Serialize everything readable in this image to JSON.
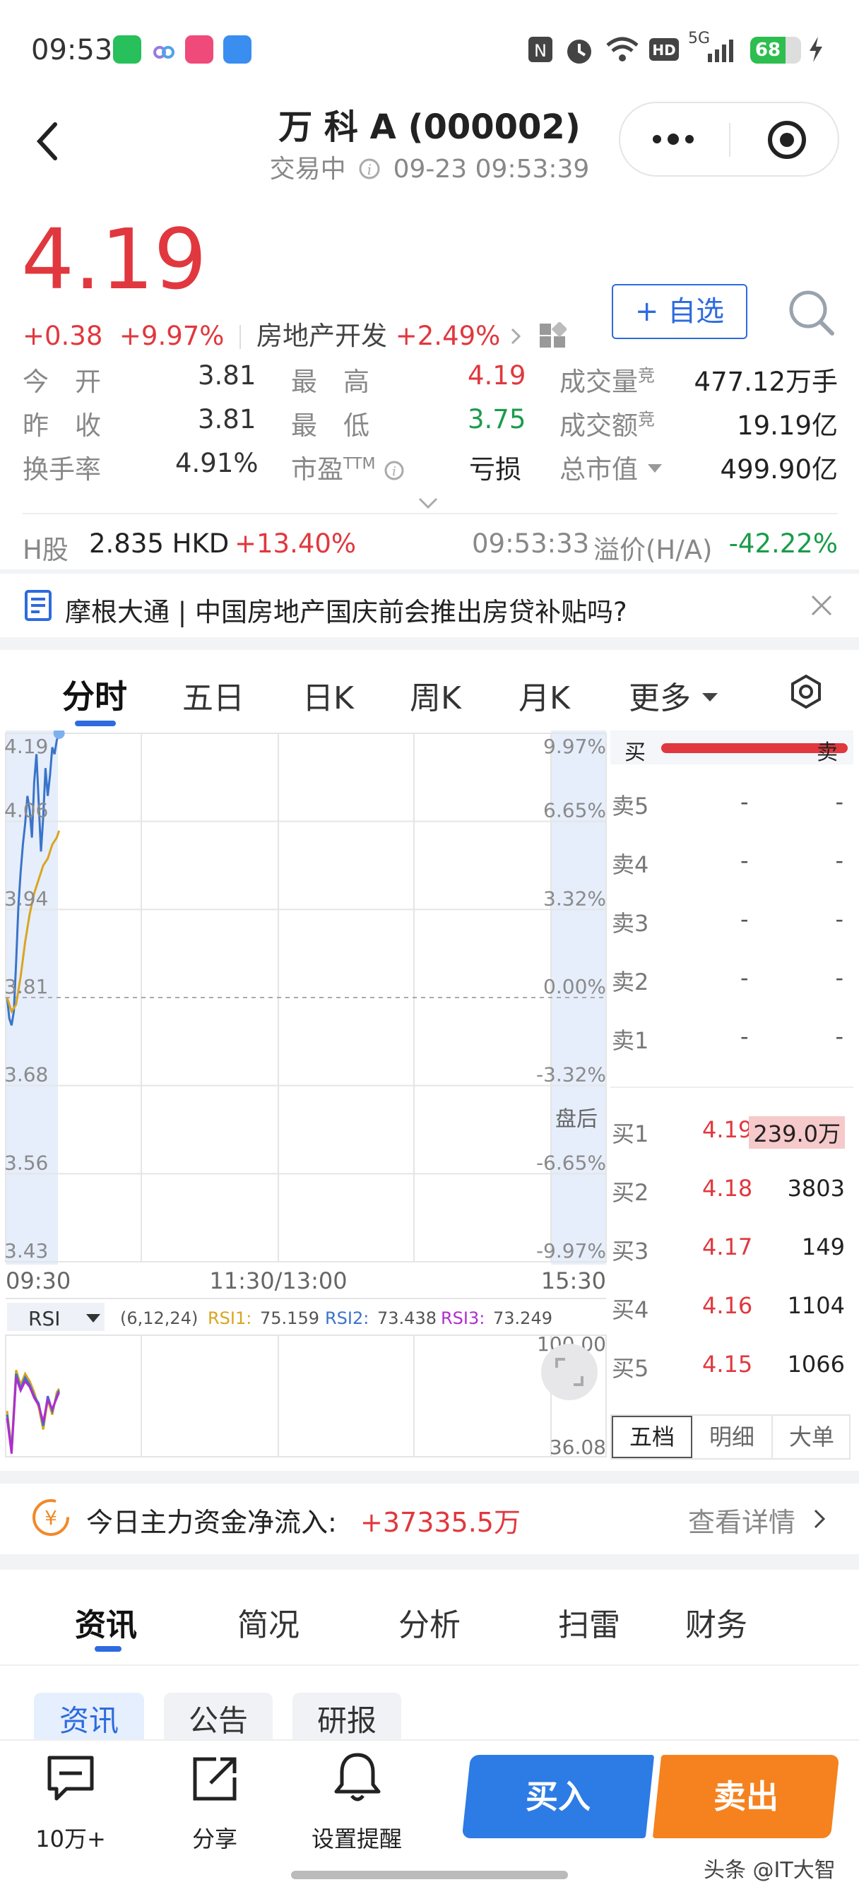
{
  "status_bar": {
    "time": "09:53",
    "network": "5G",
    "battery": "68"
  },
  "header": {
    "title": "万 科 A (000002)",
    "status": "交易中",
    "datetime": "09-23 09:53:39"
  },
  "quote": {
    "price": "4.19",
    "change": "+0.38",
    "change_pct": "+9.97%",
    "sector": "房地产开发",
    "sector_pct": "+2.49%",
    "favorite_label": "+ 自选",
    "rows": [
      [
        {
          "label": "今　开",
          "value": "3.81"
        },
        {
          "label": "最　高",
          "value": "4.19",
          "color": "red"
        },
        {
          "label": "成交量",
          "sup": "竞",
          "value": "477.12万手"
        }
      ],
      [
        {
          "label": "昨　收",
          "value": "3.81"
        },
        {
          "label": "最　低",
          "value": "3.75",
          "color": "green"
        },
        {
          "label": "成交额",
          "sup": "竞",
          "value": "19.19亿"
        }
      ],
      [
        {
          "label": "换手率",
          "value": "4.91%"
        },
        {
          "label": "市盈",
          "sup": "TTM",
          "value": "亏损",
          "color": "dark"
        },
        {
          "label": "总市值",
          "value": "499.90亿"
        }
      ]
    ]
  },
  "hshare": {
    "label": "H股",
    "price": "2.835 HKD",
    "pct": "+13.40%",
    "time": "09:53:33",
    "premium_label": "溢价(H/A)",
    "premium": "-42.22%"
  },
  "news": {
    "text": "摩根大通 | 中国房地产国庆前会推出房贷补贴吗?"
  },
  "chart_tabs": [
    "分时",
    "五日",
    "日K",
    "周K",
    "月K",
    "更多"
  ],
  "chart_data": {
    "type": "line",
    "y_left_ticks": [
      "4.19",
      "4.06",
      "3.94",
      "3.81",
      "3.68",
      "3.56",
      "3.43"
    ],
    "y_right_ticks": [
      "9.97%",
      "6.65%",
      "3.32%",
      "0.00%",
      "-3.32%",
      "-6.65%",
      "-9.97%"
    ],
    "x_ticks": [
      "09:30",
      "11:30/13:00",
      "15:30"
    ],
    "ylim": [
      3.43,
      4.19
    ],
    "after_hours_label": "盘后",
    "series": [
      {
        "name": "",
        "color": "#3a74c9",
        "x": [
          0,
          1,
          2,
          3,
          4,
          5,
          6,
          7,
          8,
          9,
          10,
          11,
          12,
          13,
          14,
          15,
          16,
          17,
          18,
          19,
          20,
          21,
          22,
          23
        ],
        "y": [
          3.81,
          3.78,
          3.77,
          3.79,
          3.86,
          3.94,
          3.99,
          4.03,
          4.06,
          4.1,
          4.08,
          4.04,
          4.12,
          4.16,
          4.09,
          4.02,
          4.07,
          4.14,
          4.1,
          4.13,
          4.17,
          4.16,
          4.18,
          4.19
        ]
      },
      {
        "name": "",
        "color": "#d9a521",
        "x": [
          0,
          2,
          4,
          6,
          8,
          10,
          12,
          14,
          16,
          18,
          20,
          22,
          23
        ],
        "y": [
          3.81,
          3.79,
          3.8,
          3.84,
          3.89,
          3.93,
          3.96,
          3.98,
          4.0,
          4.01,
          4.03,
          4.04,
          4.05
        ]
      }
    ],
    "rsi": {
      "label": "RSI",
      "params": "(6,12,24)",
      "rsi1_label": "RSI1:",
      "rsi1": "75.159",
      "rsi2_label": "RSI2:",
      "rsi2": "73.438",
      "rsi3_label": "RSI3:",
      "rsi3": "73.249",
      "top": "100.00",
      "bottom": "36.08",
      "ylim": [
        36.08,
        100
      ],
      "series": [
        {
          "color": "#d9a521",
          "x": [
            0,
            2,
            4,
            6,
            8,
            10,
            12,
            14,
            16,
            18,
            20,
            22,
            23
          ],
          "y": [
            60,
            40,
            82,
            74,
            80,
            76,
            70,
            62,
            50,
            66,
            58,
            70,
            72
          ]
        },
        {
          "color": "#3a74c9",
          "x": [
            0,
            2,
            4,
            6,
            8,
            10,
            12,
            14,
            16,
            18,
            20,
            22,
            23
          ],
          "y": [
            58,
            38,
            80,
            72,
            78,
            74,
            68,
            64,
            52,
            68,
            60,
            68,
            71
          ]
        },
        {
          "color": "#b02dd0",
          "x": [
            0,
            2,
            4,
            6,
            8,
            10,
            12,
            14,
            16,
            18,
            20,
            22,
            23
          ],
          "y": [
            56,
            37,
            78,
            71,
            76,
            73,
            67,
            63,
            54,
            66,
            61,
            67,
            70
          ]
        }
      ]
    }
  },
  "order_book": {
    "header_buy": "买",
    "header_sell": "卖",
    "asks": [
      {
        "label": "卖5",
        "price": "-",
        "vol": "-"
      },
      {
        "label": "卖4",
        "price": "-",
        "vol": "-"
      },
      {
        "label": "卖3",
        "price": "-",
        "vol": "-"
      },
      {
        "label": "卖2",
        "price": "-",
        "vol": "-"
      },
      {
        "label": "卖1",
        "price": "-",
        "vol": "-"
      }
    ],
    "bids": [
      {
        "label": "买1",
        "price": "4.19",
        "vol": "239.0万"
      },
      {
        "label": "买2",
        "price": "4.18",
        "vol": "3803"
      },
      {
        "label": "买3",
        "price": "4.17",
        "vol": "149"
      },
      {
        "label": "买4",
        "price": "4.16",
        "vol": "1104"
      },
      {
        "label": "买5",
        "price": "4.15",
        "vol": "1066"
      }
    ],
    "tabs": [
      "五档",
      "明细",
      "大单"
    ]
  },
  "capital_flow": {
    "label": "今日主力资金净流入:",
    "value": "+37335.5万",
    "detail": "查看详情"
  },
  "bottom_tabs": [
    "资讯",
    "简况",
    "分析",
    "扫雷",
    "财务"
  ],
  "sub_tabs": [
    "资讯",
    "公告",
    "研报"
  ],
  "toolbar": {
    "comments": "10万+",
    "share": "分享",
    "alert": "设置提醒",
    "buy": "买入",
    "sell": "卖出"
  },
  "watermark": "头条 @IT大智"
}
